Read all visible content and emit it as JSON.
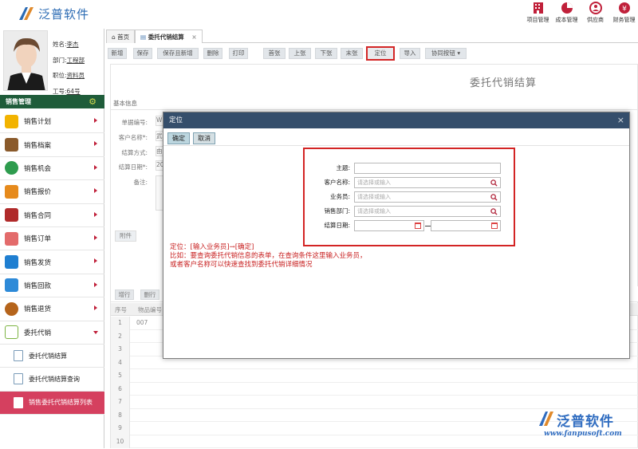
{
  "app": {
    "logo_text": "泛普软件"
  },
  "topnav": [
    {
      "label": "项目管理",
      "icon": "building-icon"
    },
    {
      "label": "成本管理",
      "icon": "pie-chart-icon"
    },
    {
      "label": "供应商",
      "icon": "supplier-icon"
    },
    {
      "label": "财务管理",
      "icon": "finance-icon"
    }
  ],
  "profile": {
    "name_label": "姓名:",
    "name": "李杰",
    "dept_label": "部门:",
    "dept": "工程部",
    "role_label": "职位:",
    "role": "资料员",
    "id_label": "工号:",
    "id": "64号"
  },
  "sidebar": {
    "section_title": "销售管理",
    "items": [
      {
        "label": "销售计划",
        "icon": "plan-icon",
        "color": "#f2b300"
      },
      {
        "label": "销售档案",
        "icon": "archive-icon",
        "color": "#8a5a2b"
      },
      {
        "label": "销售机会",
        "icon": "target-icon",
        "color": "#2e9c4e"
      },
      {
        "label": "销售报价",
        "icon": "quote-icon",
        "color": "#e68a1c"
      },
      {
        "label": "销售合同",
        "icon": "contract-icon",
        "color": "#b02a2a"
      },
      {
        "label": "销售订单",
        "icon": "order-icon",
        "color": "#e36b6b"
      },
      {
        "label": "销售发货",
        "icon": "airplane-icon",
        "color": "#1f7fd1"
      },
      {
        "label": "销售回款",
        "icon": "payment-icon",
        "color": "#2d8ad8"
      },
      {
        "label": "销售退货",
        "icon": "return-icon",
        "color": "#b5641b"
      },
      {
        "label": "委托代销",
        "icon": "consign-icon",
        "color": "#7cb342"
      }
    ],
    "sub_items": [
      {
        "label": "委托代销结算"
      },
      {
        "label": "委托代销结算查询"
      },
      {
        "label": "销售委托代销结算列表"
      }
    ]
  },
  "tabs": [
    {
      "label": "首页"
    },
    {
      "label": "委托代销结算"
    }
  ],
  "toolbar": [
    "新增",
    "保存",
    "保存且新增",
    "删除",
    "打印",
    "首张",
    "上张",
    "下张",
    "末张",
    "定位",
    "导入",
    "协同按钮"
  ],
  "form": {
    "title": "委托代销结算",
    "section": "基本信息",
    "fields": [
      "单据编号:",
      "客户名称*:",
      "结算方式:",
      "结算日期*:",
      "备注:"
    ],
    "field_values": [
      "W",
      "武",
      "由",
      "20",
      ""
    ],
    "attach": "附件"
  },
  "grid": {
    "buttons": [
      "增行",
      "删行"
    ],
    "headers": [
      "序号",
      "物品编号"
    ],
    "rows": [
      "1",
      "2",
      "3",
      "4",
      "5",
      "6",
      "7",
      "8",
      "9",
      "10"
    ],
    "first_cell": "007"
  },
  "modal": {
    "title": "定位",
    "confirm": "确定",
    "cancel": "取消",
    "fields": {
      "subject_label": "主题:",
      "customer_label": "客户名称:",
      "customer_placeholder": "请选择或输入",
      "salesman_label": "业务员:",
      "salesman_placeholder": "请选择或输入",
      "dept_label": "销售部门:",
      "dept_placeholder": "请选择或输入",
      "date_label": "结算日期:"
    },
    "note": [
      "定位：[输入业务员]→[确定]",
      "比如：要查询委托代销信息的表单，在查询条件这里输入业务员，",
      "或者客户名称可以快速查找到委托代销详细情况"
    ]
  },
  "watermark": {
    "text": "泛普软件",
    "url": "www.fanpusoft.com"
  }
}
